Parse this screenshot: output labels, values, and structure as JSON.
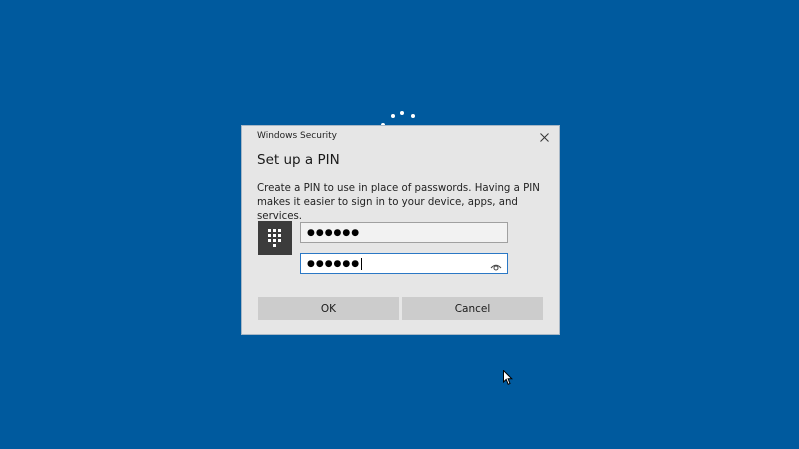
{
  "desktop": {
    "background_color": "#005a9e"
  },
  "dialog": {
    "window_title": "Windows Security",
    "heading": "Set up a PIN",
    "description_line1": "Create a PIN to use in place of passwords. Having a PIN",
    "description_line2": "makes it easier to sign in to your device, apps, and services.",
    "pin_field_value": "●●●●●●",
    "confirm_pin_field_value": "●●●●●●",
    "ok_label": "OK",
    "cancel_label": "Cancel",
    "icons": {
      "close": "close-icon",
      "pin": "keypad-icon",
      "reveal": "eye-icon"
    },
    "colors": {
      "dialog_bg": "#e6e6e6",
      "button_bg": "#cccccc",
      "focus_border": "#2b78c5"
    }
  }
}
